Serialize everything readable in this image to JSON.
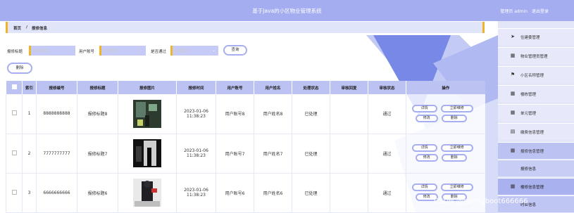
{
  "header": {
    "title": "基于Java的小区物业管理系统",
    "user_text": "管理员 admin",
    "logout": "退出登录"
  },
  "breadcrumb": {
    "home": "首页",
    "sep": "/",
    "current": "报修信息"
  },
  "search": {
    "title_label": "报修标题",
    "title_placeholder": "报修标题",
    "account_label": "用户账号",
    "account_placeholder": "用户账号",
    "handled_label": "是否通过",
    "handled_placeholder": "是否通过",
    "query_button": "查询",
    "delete_button": "删除"
  },
  "table": {
    "columns": [
      "索引",
      "报修编号",
      "报修标题",
      "报修图片",
      "报修时间",
      "用户账号",
      "用户姓名",
      "处理状态",
      "审核回复",
      "审核状态",
      "操作"
    ],
    "rows": [
      {
        "index": "1",
        "number": "8888888888",
        "title": "报修标题8",
        "time": "2023-01-06 11:38:23",
        "account": "用户账号8",
        "name": "用户姓名8",
        "status": "已处理",
        "reply": "",
        "audit": "通过"
      },
      {
        "index": "2",
        "number": "7777777777",
        "title": "报修标题7",
        "time": "2023-01-06 11:38:23",
        "account": "用户账号7",
        "name": "用户姓名7",
        "status": "已处理",
        "reply": "",
        "audit": "通过"
      },
      {
        "index": "3",
        "number": "6666666666",
        "title": "报修标题6",
        "time": "2023-01-06 11:38:23",
        "account": "用户账号6",
        "name": "用户姓名6",
        "status": "已处理",
        "reply": "",
        "audit": "通过"
      }
    ],
    "actions": {
      "detail": "详情",
      "repair": "立即维修",
      "edit": "修改",
      "delete": "删除"
    }
  },
  "sidebar": {
    "items": [
      {
        "label": "住建委管理",
        "icon": "send-icon"
      },
      {
        "label": "物业管理员管理",
        "icon": "grid-icon"
      },
      {
        "label": "小区名称管理",
        "icon": "flag-icon"
      },
      {
        "label": "楼栋管理",
        "icon": "grid-icon"
      },
      {
        "label": "单元管理",
        "icon": "grid-icon"
      },
      {
        "label": "缴费信息管理",
        "icon": "table-icon"
      },
      {
        "label": "报修信息管理",
        "icon": "grid-icon"
      }
    ],
    "sub_items": [
      {
        "label": "报修信息"
      }
    ],
    "overlay_items": [
      {
        "label": "楼修信息管理",
        "icon": "grid-icon"
      },
      {
        "label": "时业信息"
      }
    ]
  },
  "watermark": "CSDN @springboot666666"
}
